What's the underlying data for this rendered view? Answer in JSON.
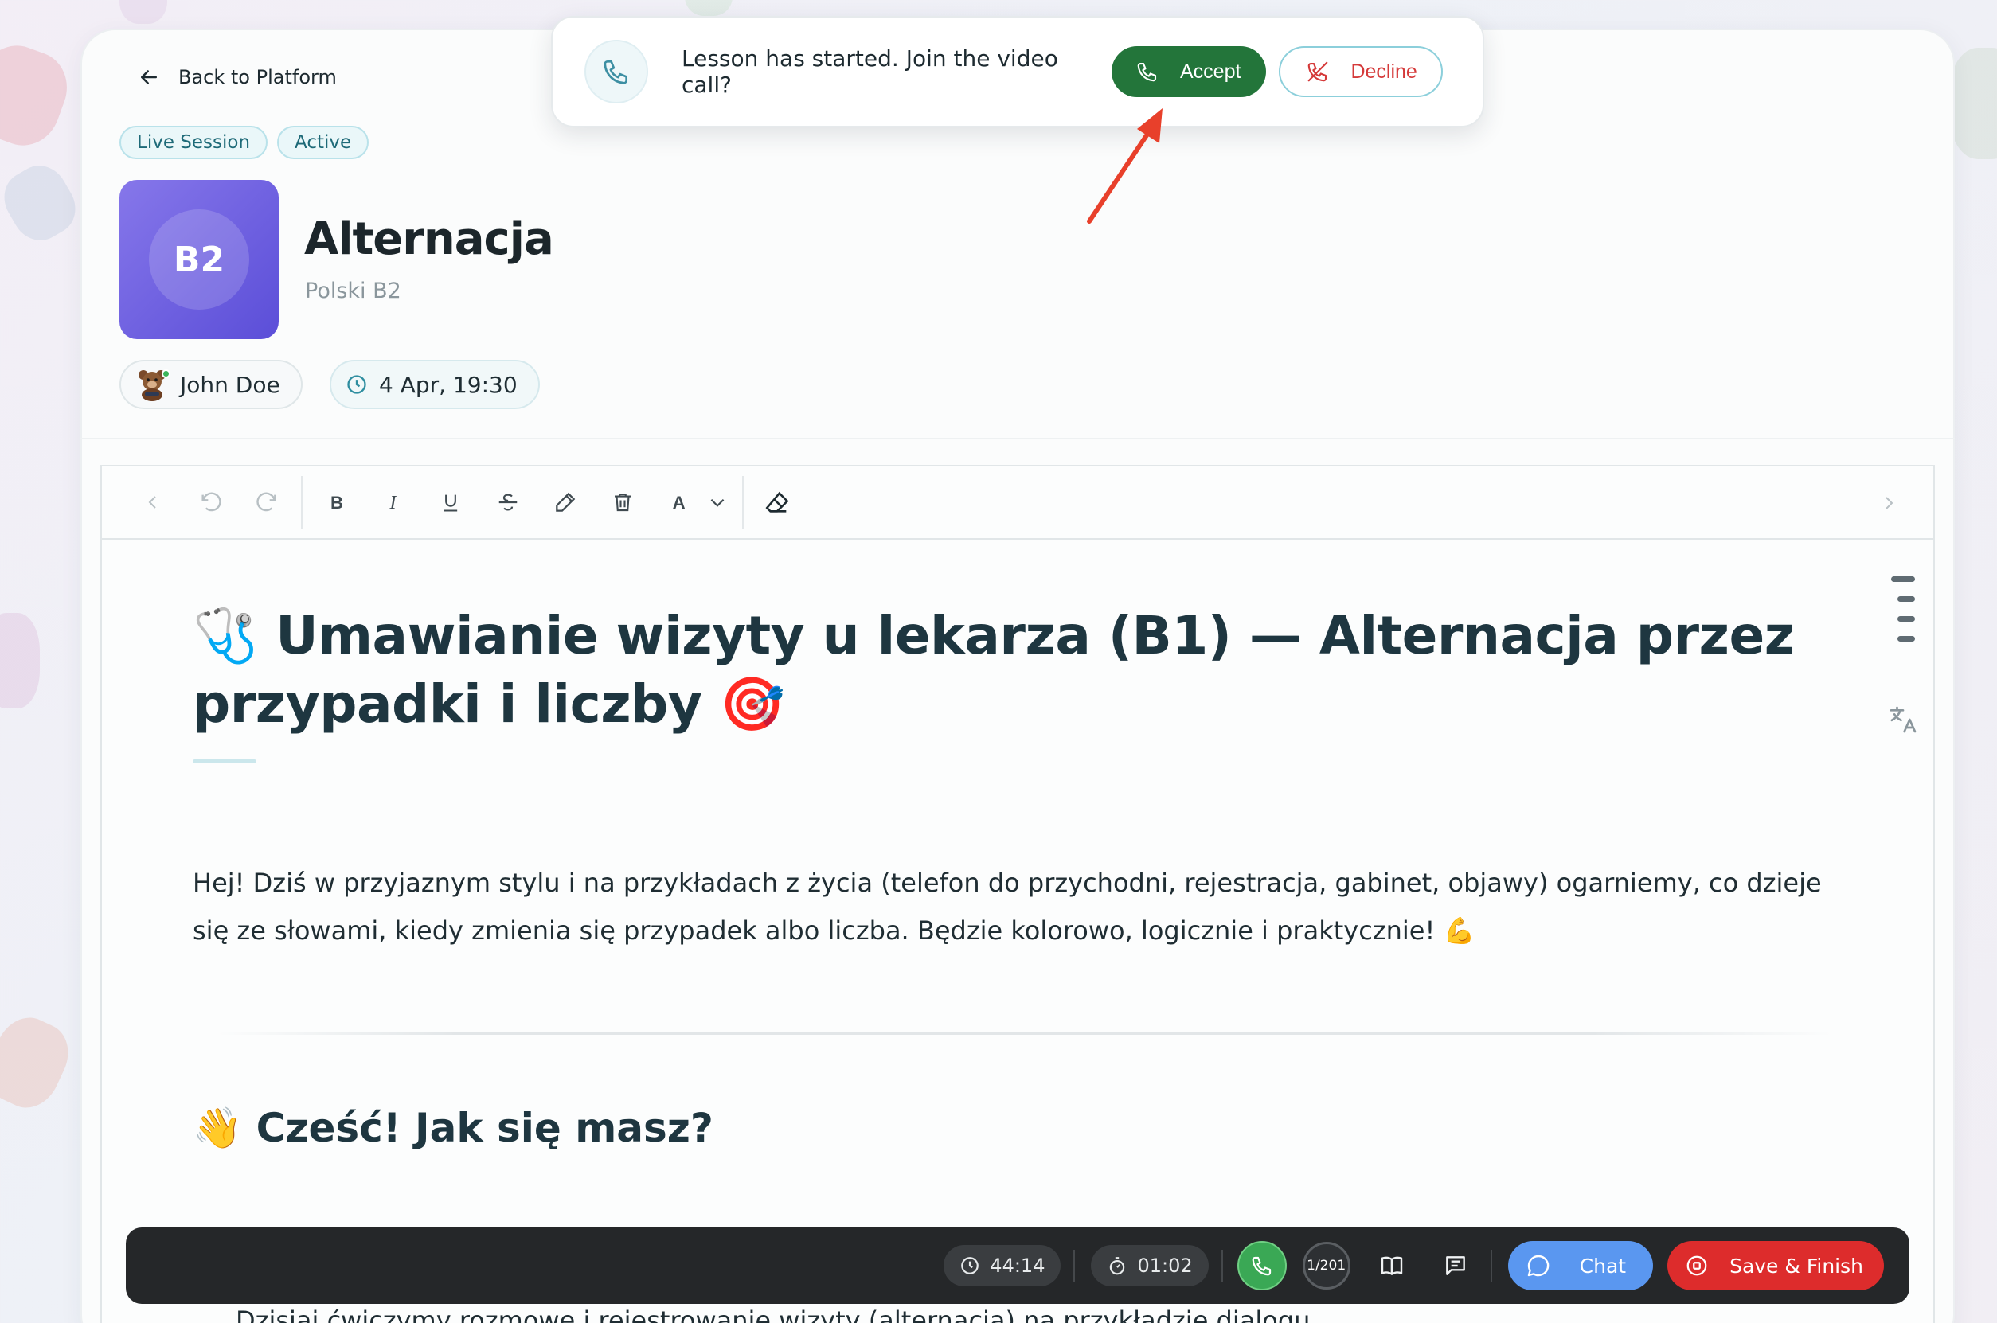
{
  "header": {
    "back_label": "Back to Platform",
    "tags": [
      "Live Session",
      "Active"
    ],
    "badge_level": "B2",
    "title": "Alternacja",
    "subtitle": "Polski B2",
    "user_name": "John Doe",
    "datetime": "4 Apr, 19:30"
  },
  "toast": {
    "message": "Lesson has started. Join the video call?",
    "accept_label": "Accept",
    "decline_label": "Decline"
  },
  "toolbar": {
    "items": [
      "chevron-left-icon",
      "undo-icon",
      "redo-icon",
      "bold-icon",
      "italic-icon",
      "underline-icon",
      "strikethrough-icon",
      "highlighter-icon",
      "trash-icon",
      "text-color-icon",
      "chevron-down-icon",
      "eraser-icon",
      "chevron-right-icon"
    ]
  },
  "document": {
    "h1_emoji_start": "🩺",
    "h1_text": "Umawianie wizyty u lekarza (B1) — Alternacja przez przypadki i liczby",
    "h1_emoji_end": "🎯",
    "intro": "Hej! Dziś w przyjaznym stylu i na przykładach z życia (telefon do przychodni, rejestracja, gabinet, objawy) ogarniemy, co dzieje się ze słowami, kiedy zmienia się przypadek albo liczba. Będzie kolorowo, logicznie i praktycznie! 💪",
    "h2": "👋 Cześć! Jak się masz?",
    "cut_line": "Dzisiaj ćwiczymy rozmowę i rejestrowanie wizyty (alternacja) na przykładzie dialogu"
  },
  "bottom_bar": {
    "timer_total": "44:14",
    "timer_elapsed": "01:02",
    "page_indicator": "1/201",
    "chat_label": "Chat",
    "save_label": "Save & Finish"
  },
  "colors": {
    "accept": "#23753a",
    "decline": "#d53a3a",
    "chat": "#5a97f0",
    "save": "#dd2c2c",
    "badge_gradient_start": "#8677ea",
    "badge_gradient_end": "#5b4ed8"
  }
}
